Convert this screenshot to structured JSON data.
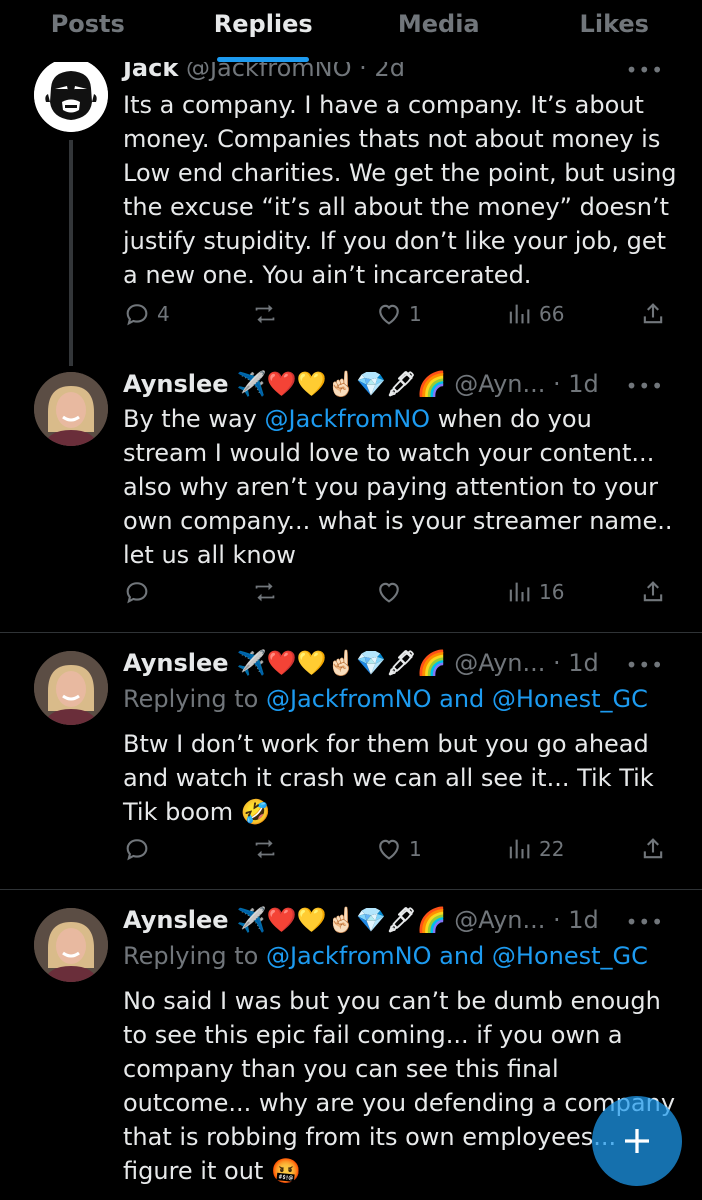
{
  "tabs": [
    {
      "label": "Posts"
    },
    {
      "label": "Replies"
    },
    {
      "label": "Media"
    },
    {
      "label": "Likes"
    }
  ],
  "active_tab": "Replies",
  "colors": {
    "accent": "#1d9bf0",
    "muted": "#71767b",
    "text": "#e7e9ea",
    "background": "#000000"
  },
  "tweets": [
    {
      "name": "Jack",
      "handle": "@JackfromNO",
      "time": "· 2d",
      "text": "Its a company. I have a company. It’s about money. Companies thats not about money is Low end charities. We get the point, but using the excuse “it’s all about the money” doesn’t justify stupidity. If you don’t like your job, get a new one. You ain’t incarcerated.",
      "replies": "4",
      "reposts": "",
      "likes": "1",
      "views": "66"
    },
    {
      "name": "Aynslee ✈️❤️💛☝🏻💎🖋🌈",
      "handle": "@Ayn...",
      "time": "· 1d",
      "text_before": "By the way ",
      "mention": "@JackfromNO",
      "text_after": " when do you stream I would love to watch your content... also why aren’t you paying attention to your own company... what is your streamer name.. let us all know",
      "replies": "",
      "reposts": "",
      "likes": "",
      "views": "16"
    },
    {
      "name": "Aynslee ✈️❤️💛☝🏻💎🖋🌈",
      "handle": "@Ayn...",
      "time": "· 1d",
      "replying_prefix": "Replying to ",
      "replying_mentions": "@JackfromNO and @Honest_GC",
      "text": "Btw I don’t work for them but you go ahead and watch it crash we can all see it... Tik Tik Tik boom 🤣",
      "replies": "",
      "reposts": "",
      "likes": "1",
      "views": "22"
    },
    {
      "name": "Aynslee ✈️❤️💛☝🏻💎🖋🌈",
      "handle": "@Ayn...",
      "time": "· 1d",
      "replying_prefix": "Replying to ",
      "replying_mentions": "@JackfromNO and @Honest_GC",
      "text": "No said I was but you can’t be dumb enough to see this epic fail coming... if you own a company than you can see this final outcome... why are you defending a company that is robbing from its own employees... figure it out 🤬"
    }
  ],
  "icons": {
    "reply": "reply-icon",
    "repost": "repost-icon",
    "like": "heart-icon",
    "views": "views-icon",
    "share": "share-icon",
    "more": "more-icon",
    "compose": "plus-icon"
  }
}
